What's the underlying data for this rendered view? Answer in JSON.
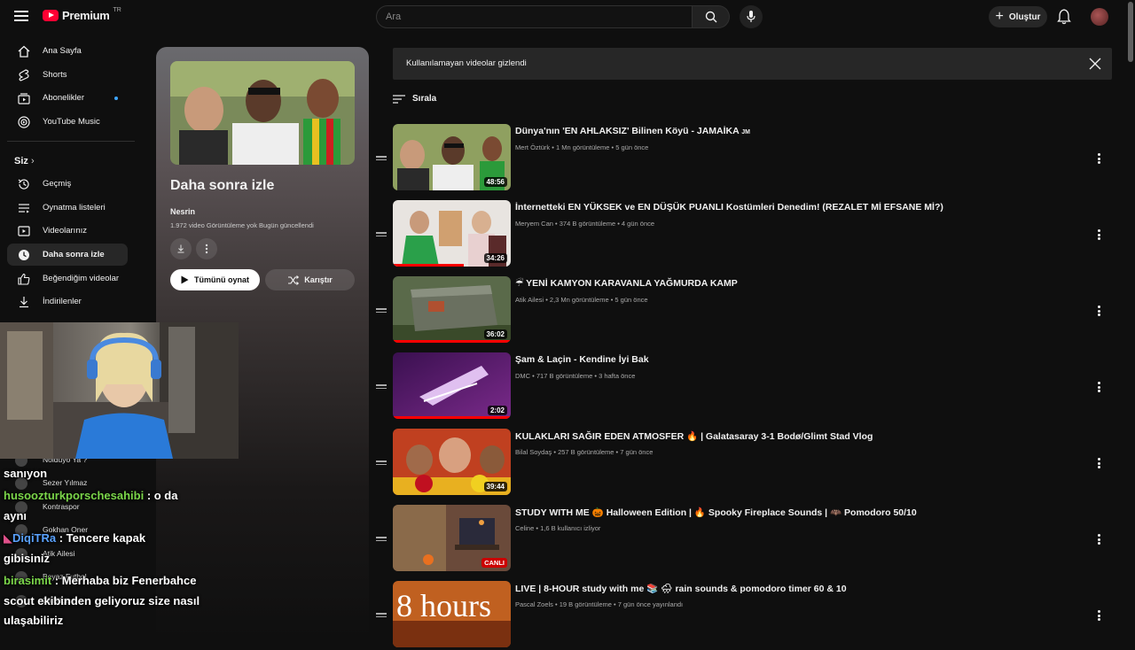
{
  "header": {
    "logo_text": "Premium",
    "logo_region": "TR",
    "search_placeholder": "Ara",
    "create_label": "Oluştur"
  },
  "sidebar": {
    "items": [
      {
        "label": "Ana Sayfa",
        "icon": "home-icon"
      },
      {
        "label": "Shorts",
        "icon": "shorts-icon"
      },
      {
        "label": "Abonelikler",
        "icon": "subscriptions-icon",
        "dot": true
      },
      {
        "label": "YouTube Music",
        "icon": "youtube-music-icon"
      }
    ],
    "you_section": "Siz",
    "you_items": [
      {
        "label": "Geçmiş",
        "icon": "history-icon"
      },
      {
        "label": "Oynatma listeleri",
        "icon": "playlists-icon"
      },
      {
        "label": "Videolarınız",
        "icon": "your-videos-icon"
      },
      {
        "label": "Daha sonra izle",
        "icon": "watch-later-icon",
        "active": true
      },
      {
        "label": "Beğendiğim videolar",
        "icon": "liked-videos-icon"
      },
      {
        "label": "İndirilenler",
        "icon": "downloads-icon"
      }
    ]
  },
  "playlist": {
    "title": "Daha sonra izle",
    "owner": "Nesrin",
    "meta": "1.972 video  Görüntüleme yok  Bugün güncellendi",
    "play_all": "Tümünü oynat",
    "shuffle": "Karıştır"
  },
  "banner": {
    "text": "Kullanılamayan videolar gizlendi"
  },
  "sort_label": "Sırala",
  "videos": [
    {
      "title": "Dünya'nın 'EN AHLAKSIZ' Bilinen Köyü - JAMAİKA",
      "title_suffix": "JM",
      "channel": "Mert Öztürk",
      "views": "1 Mn görüntüleme",
      "age": "5 gün önce",
      "duration": "48:56",
      "progress": 0
    },
    {
      "title": "İnternetteki EN YÜKSEK ve EN DÜŞÜK PUANLI Kostümleri Denedim! (REZALET Mİ EFSANE Mİ?)",
      "channel": "Meryem Can",
      "views": "374 B görüntüleme",
      "age": "4 gün önce",
      "duration": "34:26",
      "progress": 0.6
    },
    {
      "title": "☔ YENİ KAMYON KARAVANLA YAĞMURDA KAMP",
      "channel": "Atik Ailesi",
      "views": "2,3 Mn görüntüleme",
      "age": "5 gün önce",
      "duration": "36:02",
      "progress": 1
    },
    {
      "title": "Şam & Laçin - Kendine İyi Bak",
      "channel": "DMC",
      "views": "717 B görüntüleme",
      "age": "3 hafta önce",
      "duration": "2:02",
      "progress": 1
    },
    {
      "title": "KULAKLARI SAĞIR EDEN ATMOSFER 🔥 | Galatasaray 3-1 Bodø/Glimt Stad Vlog",
      "channel": "Bilal Soydaş",
      "views": "257 B görüntüleme",
      "age": "7 gün önce",
      "duration": "39:44",
      "progress": 0
    },
    {
      "title": "STUDY WITH ME 🎃 Halloween Edition | 🔥 Spooky Fireplace Sounds | 🦇 Pomodoro 50/10",
      "channel": "Celine",
      "views": "1,6 B kullanıcı izliyor",
      "age": "",
      "duration": "CANLI",
      "live": true,
      "progress": 0
    },
    {
      "title": "LIVE | 8-HOUR study with me 📚 🌧 rain sounds & pomodoro timer 60 & 10",
      "channel": "Pascal Zoels",
      "views": "19 B görüntüleme",
      "age": "7 gün önce yayınlandı",
      "duration": "",
      "progress": 0
    }
  ],
  "subscriptions_ghost": [
    "Nolduyo Ya ?",
    "Sezer Yılmaz",
    "Kontraspor",
    "Gokhan Oner",
    "Atik Ailesi",
    "Beyaz Futbol",
    "26 Bilgisel"
  ],
  "chat": [
    {
      "user": "",
      "text": "sanıyon"
    },
    {
      "user": "husoozturkporschesahibi",
      "text": " : o da",
      "user_color": "green"
    },
    {
      "user": "",
      "text": "aynı"
    },
    {
      "user": "DiqiTRa",
      "text": " : Tencere kapak",
      "user_color": "blue"
    },
    {
      "user": "",
      "text": "gibisiniz"
    },
    {
      "user": "birasimit",
      "text": " : Merhaba biz Fenerbahce",
      "user_color": "green"
    },
    {
      "user": "",
      "text": "scout ekibinden geliyoruz size nasıl"
    },
    {
      "user": "",
      "text": "ulaşabiliriz"
    }
  ]
}
